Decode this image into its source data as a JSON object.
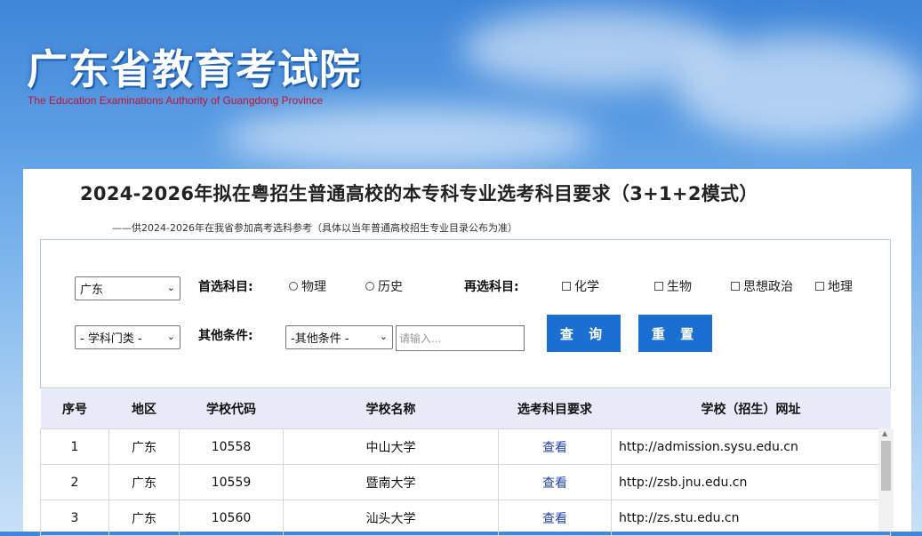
{
  "header": {
    "logo_cn": "广东省教育考试院",
    "logo_en": "The Education Examinations Authority of Guangdong Province"
  },
  "page": {
    "title": "2024-2026年拟在粤招生普通高校的本专科专业选考科目要求（3+1+2模式）",
    "subtitle": "——供2024-2026年在我省参加高考选科参考（具体以当年普通高校招生专业目录公布为准）"
  },
  "filters": {
    "region_value": "广东",
    "category_value": "- 学科门类 -",
    "first_subject_label": "首选科目:",
    "first_options": [
      "物理",
      "历史"
    ],
    "second_subject_label": "再选科目:",
    "second_options": [
      "化学",
      "生物",
      "思想政治",
      "地理"
    ],
    "other_label": "其他条件:",
    "other_value": "-其他条件 -",
    "input_placeholder": "请输入...",
    "query_button": "查 询",
    "reset_button": "重 置"
  },
  "table": {
    "headers": [
      "序号",
      "地区",
      "学校代码",
      "学校名称",
      "选考科目要求",
      "学校（招生）网址"
    ],
    "rows": [
      [
        "1",
        "广东",
        "10558",
        "中山大学",
        "查看",
        "http://admission.sysu.edu.cn"
      ],
      [
        "2",
        "广东",
        "10559",
        "暨南大学",
        "查看",
        "http://zsb.jnu.edu.cn"
      ],
      [
        "3",
        "广东",
        "10560",
        "汕头大学",
        "查看",
        "http://zs.stu.edu.cn"
      ]
    ]
  },
  "colors": {
    "accent": "#1b6fd2",
    "link": "#1f3fb3",
    "logo_en": "#c8102e"
  }
}
